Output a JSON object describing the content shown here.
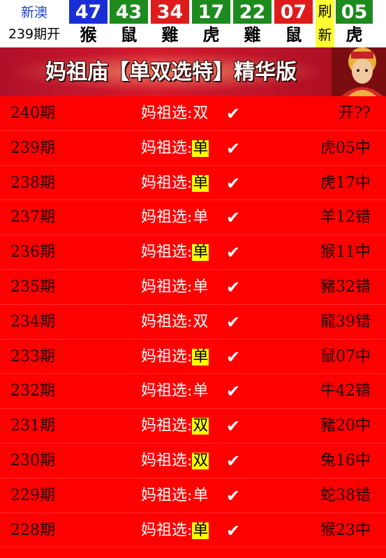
{
  "header": {
    "brand_line1": "新澳",
    "brand_line2": "239期开",
    "balls": [
      {
        "number": "47",
        "zodiac": "猴",
        "color": "#1a2ed6"
      },
      {
        "number": "43",
        "zodiac": "鼠",
        "color": "#1d8a1d"
      },
      {
        "number": "34",
        "zodiac": "雞",
        "color": "#e01b1b"
      },
      {
        "number": "17",
        "zodiac": "虎",
        "color": "#1d8a1d"
      },
      {
        "number": "22",
        "zodiac": "雞",
        "color": "#1d8a1d"
      },
      {
        "number": "07",
        "zodiac": "鼠",
        "color": "#e01b1b"
      },
      {
        "number": "05",
        "zodiac": "虎",
        "color": "#1d8a1d"
      }
    ],
    "refresh_line1": "刷",
    "refresh_line2": "新"
  },
  "banner": {
    "title": "妈祖庙【单双选特】精华版"
  },
  "rows": [
    {
      "period": "240期",
      "label": "妈祖选:",
      "pick": "双",
      "highlight": false,
      "check": "✔",
      "result": "开??"
    },
    {
      "period": "239期",
      "label": "妈祖选:",
      "pick": "单",
      "highlight": true,
      "check": "✔",
      "result": "虎05中"
    },
    {
      "period": "238期",
      "label": "妈祖选:",
      "pick": "单",
      "highlight": true,
      "check": "✔",
      "result": "虎17中"
    },
    {
      "period": "237期",
      "label": "妈祖选:",
      "pick": "单",
      "highlight": false,
      "check": "✔",
      "result": "羊12错"
    },
    {
      "period": "236期",
      "label": "妈祖选:",
      "pick": "单",
      "highlight": true,
      "check": "✔",
      "result": "猴11中"
    },
    {
      "period": "235期",
      "label": "妈祖选:",
      "pick": "单",
      "highlight": false,
      "check": "✔",
      "result": "豬32错"
    },
    {
      "period": "234期",
      "label": "妈祖选:",
      "pick": "双",
      "highlight": false,
      "check": "✔",
      "result": "龍39错"
    },
    {
      "period": "233期",
      "label": "妈祖选:",
      "pick": "单",
      "highlight": true,
      "check": "✔",
      "result": "鼠07中"
    },
    {
      "period": "232期",
      "label": "妈祖选:",
      "pick": "单",
      "highlight": false,
      "check": "✔",
      "result": "牛42错"
    },
    {
      "period": "231期",
      "label": "妈祖选:",
      "pick": "双",
      "highlight": true,
      "check": "✔",
      "result": "豬20中"
    },
    {
      "period": "230期",
      "label": "妈祖选:",
      "pick": "双",
      "highlight": true,
      "check": "✔",
      "result": "兔16中"
    },
    {
      "period": "229期",
      "label": "妈祖选:",
      "pick": "单",
      "highlight": false,
      "check": "✔",
      "result": "蛇38错"
    },
    {
      "period": "228期",
      "label": "妈祖选:",
      "pick": "单",
      "highlight": true,
      "check": "✔",
      "result": "猴23中"
    }
  ]
}
